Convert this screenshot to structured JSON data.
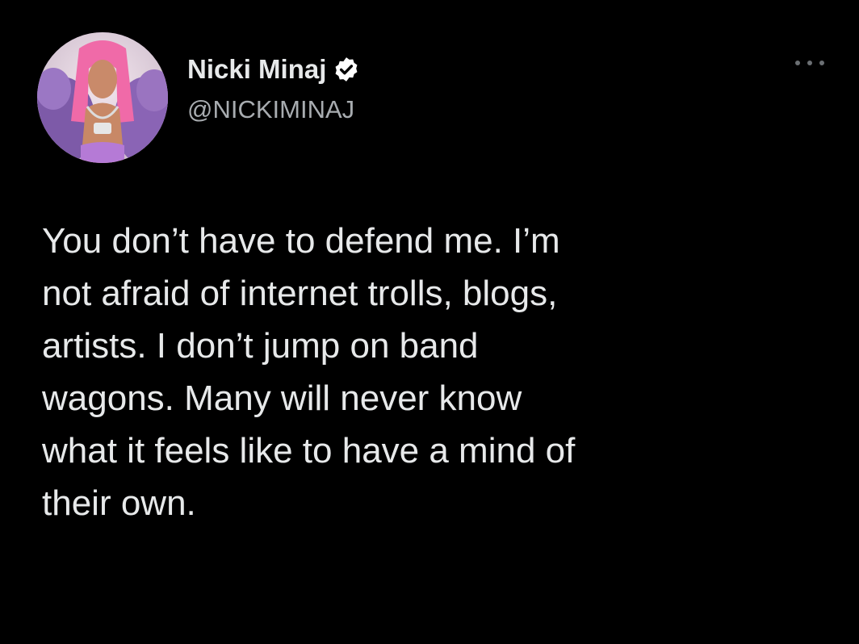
{
  "user": {
    "display_name": "Nicki Minaj",
    "handle": "@NICKIMINAJ",
    "verified": true,
    "avatar_icon": "profile-photo",
    "verified_icon": "verified-badge-icon",
    "more_icon": "more-options-icon"
  },
  "tweet": {
    "text": "You don’t have to defend me. I’m\nnot afraid of internet trolls, blogs,\nartists. I don’t jump on band\nwagons. Many will never know\nwhat it feels like to have a mind of\ntheir own."
  },
  "colors": {
    "background": "#000000",
    "text_primary": "#e7e9ea",
    "text_secondary": "#a8acb0",
    "accent": "#1d9bf0"
  }
}
